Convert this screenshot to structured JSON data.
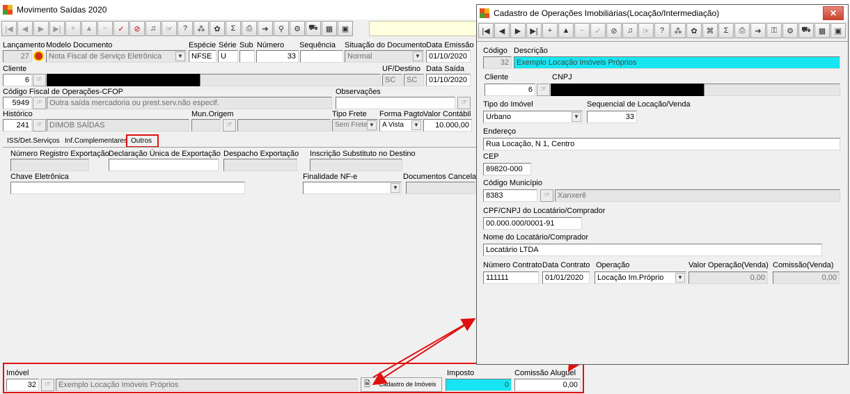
{
  "main": {
    "title": "Movimento Saídas 2020",
    "labels": {
      "lancamento": "Lançamento",
      "modelo": "Modelo Documento",
      "especie": "Espécie",
      "serie": "Série",
      "sub": "Sub",
      "numero": "Número",
      "sequencia": "Sequência",
      "situacao": "Situação do Documento",
      "data_emissao": "Data Emissão",
      "cliente": "Cliente",
      "uf_destino": "UF/Destino",
      "data_saida": "Data Saída",
      "cfop": "Código Fiscal de Operações-CFOP",
      "observacoes": "Observações",
      "historico": "Histórico",
      "mun_origem": "Mun.Origem",
      "tipo_frete": "Tipo Frete",
      "forma_pagto": "Forma Pagto",
      "valor_contabil": "Valor Contábil",
      "num_reg_export": "Número Registro Exportação",
      "decl_unica": "Declaração Única de Exportação",
      "despacho": "Despacho Exportação",
      "insc_subst": "Inscrição Substituto no Destino",
      "chave": "Chave Eletrônica",
      "finalidade": "Finalidade NF-e",
      "docs_cancel": "Documentos Cancela",
      "imovel": "Imóvel",
      "imposto": "Imposto",
      "comissao": "Comissão Aluguel"
    },
    "values": {
      "lancamento": "27",
      "modelo": "Nota Fiscal de Serviço Eletrônica",
      "especie": "NFSE",
      "serie": "U",
      "sub": "",
      "numero": "33",
      "sequencia": "",
      "situacao": "Normal",
      "data_emissao": "01/10/2020",
      "cliente": "6",
      "uf1": "SC",
      "uf2": "SC",
      "data_saida": "01/10/2020",
      "cfop": "5949",
      "cfop_desc": "Outra saída mercadoria ou prest.serv.não especif.",
      "observacoes": "",
      "historico": "241",
      "historico_desc": "DIMOB SAÍDAS",
      "tipo_frete": "Sem Frete",
      "forma_pagto": "A Vista",
      "valor_contabil": "10.000,00",
      "imovel": "32",
      "imovel_desc": "Exemplo Locação Imóveis Próprios",
      "imposto": "0",
      "comissao": "0,00"
    },
    "tabs": [
      "ISS/Det.Serviços",
      "Inf.Complementares",
      "Outros"
    ],
    "cadastro_button": "Cadastro de Imóveis"
  },
  "dialog": {
    "title": "Cadastro de Operações Imobiliárias(Locação/Intermediação)",
    "labels": {
      "codigo": "Código",
      "descricao": "Descrição",
      "cliente": "Cliente",
      "cnpj": "CNPJ",
      "tipo_imovel": "Tipo do Imóvel",
      "sequencial": "Sequencial de Locação/Venda",
      "endereco": "Endereço",
      "cep": "CEP",
      "cod_municipio": "Código Município",
      "cpf_cnpj": "CPF/CNPJ do Locatário/Comprador",
      "nome": "Nome do Locatário/Comprador",
      "num_contrato": "Número Contrato",
      "data_contrato": "Data Contrato",
      "operacao": "Operação",
      "valor_operacao": "Valor Operação(Venda)",
      "comissao_venda": "Comissão(Venda)"
    },
    "values": {
      "codigo": "32",
      "descricao": "Exemplo Locação Imóveis Próprios",
      "cliente": "6",
      "tipo_imovel": "Urbano",
      "sequencial": "33",
      "endereco": "Rua Locação, N 1, Centro",
      "cep": "89820-000",
      "cod_municipio": "8383",
      "municipio": "Xanxerê",
      "cpf_cnpj": "00.000.000/0001-91",
      "nome": "Locatário LTDA",
      "num_contrato": "111111",
      "data_contrato": "01/01/2020",
      "operacao": "Locação Im.Próprio",
      "valor_operacao": "0,00",
      "comissao_venda": "0,00"
    }
  },
  "colors": {
    "accent_red": "#e01010",
    "cyan": "#17e6f2"
  }
}
